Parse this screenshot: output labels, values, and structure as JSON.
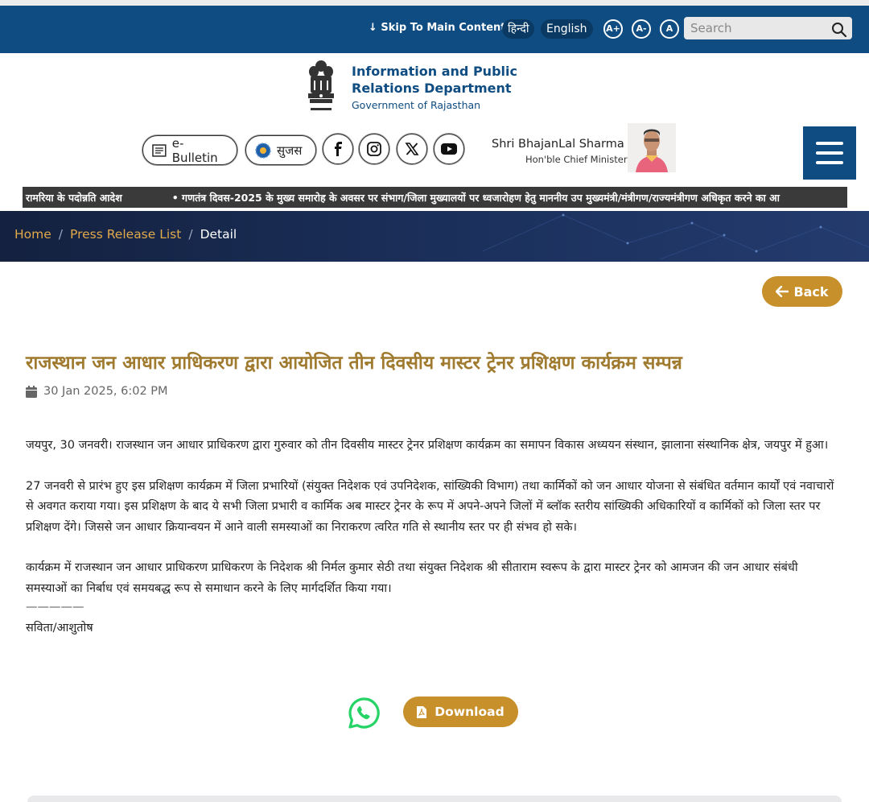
{
  "topbar": {
    "skip_label": "↓ Skip To Main Content",
    "lang_hindi": "हिन्दी",
    "lang_english": "English",
    "font_increase": "A+",
    "font_decrease": "A-",
    "font_reset": "A",
    "search_placeholder": "Search"
  },
  "header": {
    "dept_name": "Information and Public Relations Department",
    "dept_sub": "Government of Rajasthan",
    "ebulletin_label": "e-Bulletin",
    "sujas_label": "सुजस",
    "cm_name": "Shri BhajanLal Sharma",
    "cm_title": "Hon'ble Chief Minister"
  },
  "ticker": {
    "item1": "रामरिया के पदोन्नति आदेश",
    "item2": "• गणतंत्र दिवस-2025 के मुख्य समारोह के अवसर पर संभाग/जिला मुख्यालयों पर ध्वजारोहण हेतु माननीय उप मुख्यमंत्री/मंत्रीगण/राज्यमंत्रीगण अधिकृत करने का आ"
  },
  "breadcrumb": {
    "home": "Home",
    "list": "Press Release List",
    "current": "Detail",
    "sep": "/"
  },
  "back_label": "Back",
  "article": {
    "headline": "राजस्थान जन आधार प्राधिकरण द्वारा आयोजित तीन दिवसीय मास्टर ट्रेनर प्रशिक्षण कार्यक्रम सम्पन्न",
    "date": "30 Jan 2025, 6:02 PM",
    "para1": "जयपुर, 30 जनवरी। राजस्थान जन आधार प्राधिकरण द्वारा गुरुवार को तीन दिवसीय मास्टर ट्रेनर प्रशिक्षण कार्यक्रम का समापन विकास अध्ययन संस्थान, झालाना संस्थानिक क्षेत्र, जयपुर में हुआ।",
    "para2": "27 जनवरी से प्रारंभ हुए इस प्रशिक्षण कार्यक्रम में जिला प्रभारियों (संयुक्त निदेशक एवं उपनिदेशक, सांख्यिकी विभाग) तथा कार्मिकों को जन आधार योजना से संबंधित वर्तमान कार्यों एवं नवाचारों से अवगत कराया गया। इस प्रशिक्षण के बाद ये सभी जिला प्रभारी व कार्मिक अब मास्टर ट्रेनर के रूप में अपने-अपने जिलों में ब्लॉक स्तरीय सांख्यिकी अधिकारियों व कार्मिकों को जिला स्तर पर प्रशिक्षण देंगे। जिससे जन आधार क्रियान्वयन में आने वाली समस्याओं का निराकरण त्वरित गति से स्थानीय स्तर पर ही संभव हो सके।",
    "para3": "कार्यक्रम में राजस्थान जन आधार प्राधिकरण प्राधिकरण के निदेशक श्री निर्मल कुमार सेठी तथा संयुक्त निदेशक श्री सीताराम स्वरूप के द्वारा मास्टर ट्रेनर को आमजन की जन आधार संबंधी समस्याओं का निर्बाध एवं समयबद्ध रूप से समाधान करने के लिए मार्गदर्शित किया गया।",
    "divider": "—————",
    "author": "सविता/आशुतोष"
  },
  "download_label": "Download",
  "colors": {
    "brand_blue": "#0f4c81",
    "accent_gold": "#c8902a",
    "headline_gold": "#a07a2f",
    "whatsapp_green": "#25d366"
  },
  "icons": {
    "search": "search-icon",
    "back": "arrow-left-icon",
    "calendar": "calendar-icon",
    "whatsapp": "whatsapp-icon",
    "pdf": "pdf-icon"
  }
}
